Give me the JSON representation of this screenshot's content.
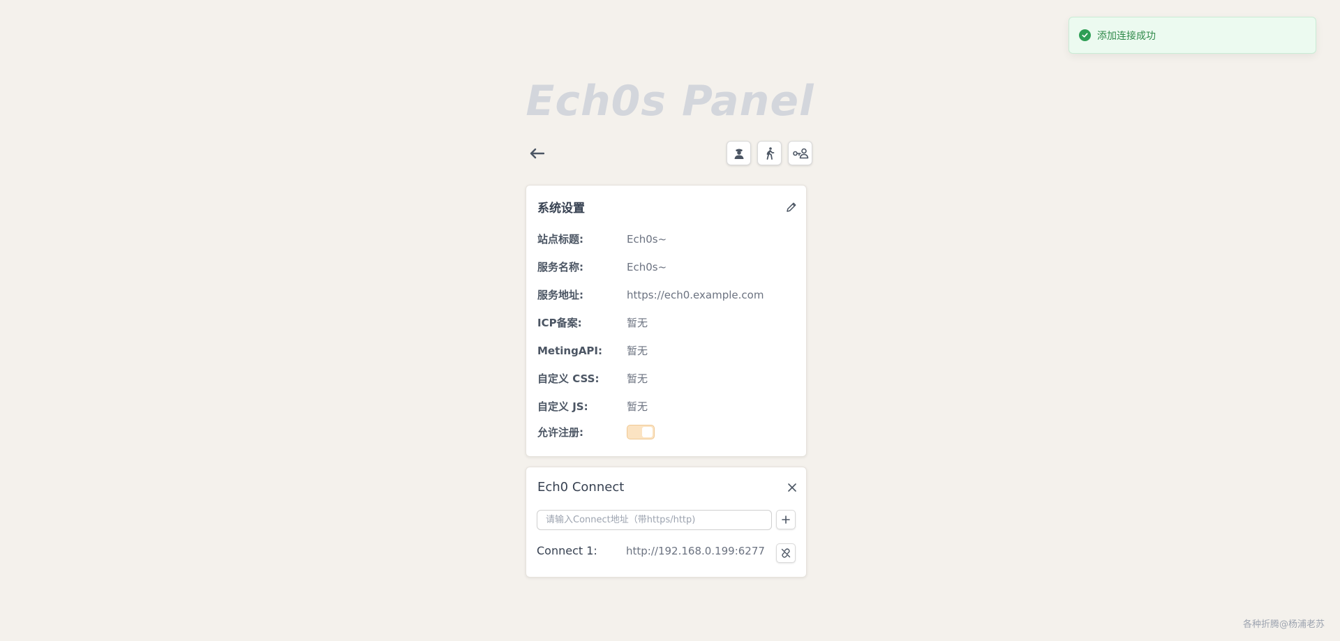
{
  "toast": {
    "message": "添加连接成功",
    "icon": "check-circle-icon",
    "color": "#2e9e55"
  },
  "header": {
    "title": "Ech0s Panel"
  },
  "toolbar": {
    "back_icon": "arrow-left-icon",
    "buttons": [
      "user-admin-icon",
      "walking-person-icon",
      "user-key-icon"
    ]
  },
  "settings": {
    "title": "系统设置",
    "edit_icon": "pencil-icon",
    "rows": [
      {
        "label": "站点标题:",
        "value": "Ech0s~"
      },
      {
        "label": "服务名称:",
        "value": "Ech0s~"
      },
      {
        "label": "服务地址:",
        "value": "https://ech0.example.com"
      },
      {
        "label": "ICP备案:",
        "value": "暂无"
      },
      {
        "label": "MetingAPI:",
        "value": "暂无"
      },
      {
        "label": "自定义 CSS:",
        "value": "暂无"
      },
      {
        "label": "自定义 JS:",
        "value": "暂无"
      }
    ],
    "register_label": "允许注册:",
    "register_enabled": true
  },
  "connect": {
    "title": "Ech0 Connect",
    "close_icon": "close-icon",
    "input_placeholder": "请输入Connect地址（带https/http)",
    "add_icon": "plus-icon",
    "items": [
      {
        "label": "Connect 1:",
        "value": "http://192.168.0.199:6277",
        "action_icon": "unlink-icon"
      }
    ]
  },
  "footer": {
    "text": "各种折腾@杨浦老苏"
  }
}
